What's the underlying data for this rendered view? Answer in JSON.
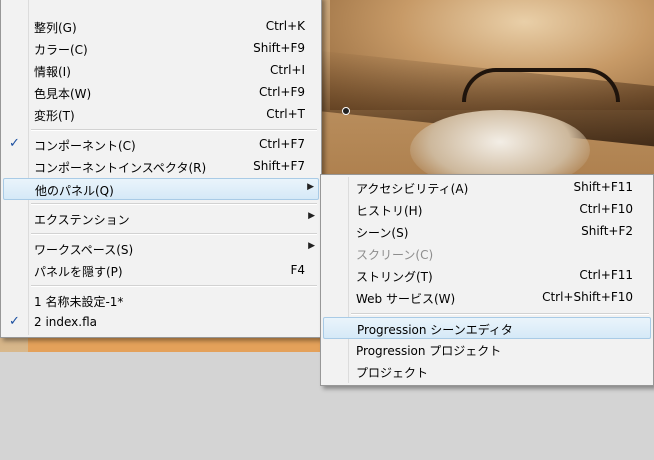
{
  "main_menu": {
    "items": [
      {
        "label": "整列(G)",
        "shortcut": "Ctrl+K"
      },
      {
        "label": "カラー(C)",
        "shortcut": "Shift+F9"
      },
      {
        "label": "情報(I)",
        "shortcut": "Ctrl+I"
      },
      {
        "label": "色見本(W)",
        "shortcut": "Ctrl+F9"
      },
      {
        "label": "変形(T)",
        "shortcut": "Ctrl+T"
      },
      {
        "label": "コンポーネント(C)",
        "shortcut": "Ctrl+F7",
        "checked": true
      },
      {
        "label": "コンポーネントインスペクタ(R)",
        "shortcut": "Shift+F7"
      },
      {
        "label": "他のパネル(Q)",
        "shortcut": "",
        "submenu": true
      },
      {
        "label": "エクステンション",
        "shortcut": "",
        "submenu": true
      },
      {
        "label": "ワークスペース(S)",
        "shortcut": "",
        "submenu": true
      },
      {
        "label": "パネルを隠す(P)",
        "shortcut": "F4"
      },
      {
        "label": "1 名称未設定-1*",
        "shortcut": ""
      },
      {
        "label": "2 index.fla",
        "shortcut": "",
        "checked": true
      }
    ],
    "check_mark": "✓",
    "arrow": "▶"
  },
  "sub_menu": {
    "items": [
      {
        "label": "アクセシビリティ(A)",
        "shortcut": "Shift+F11"
      },
      {
        "label": "ヒストリ(H)",
        "shortcut": "Ctrl+F10"
      },
      {
        "label": "シーン(S)",
        "shortcut": "Shift+F2"
      },
      {
        "label": "スクリーン(C)",
        "shortcut": "",
        "disabled": true
      },
      {
        "label": "ストリング(T)",
        "shortcut": "Ctrl+F11"
      },
      {
        "label": "Web サービス(W)",
        "shortcut": "Ctrl+Shift+F10"
      },
      {
        "label": "Progression シーンエディタ",
        "shortcut": "",
        "highlighted": true
      },
      {
        "label": "Progression プロジェクト",
        "shortcut": ""
      },
      {
        "label": "プロジェクト",
        "shortcut": ""
      }
    ]
  },
  "colors": {
    "menu_bg": "#f2f2f2",
    "highlight": "#d5e9f7",
    "check": "#1b4fa0"
  }
}
